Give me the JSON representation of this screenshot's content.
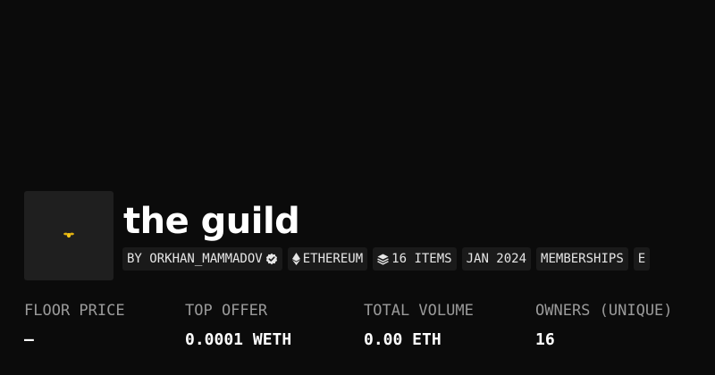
{
  "collection": {
    "name": "the guild",
    "creator_label": "BY ORKHAN_MAMMADOV",
    "creator_verified_icon": "verified-check-icon",
    "chain_label": "ETHEREUM",
    "chain_icon": "ethereum-diamond-icon",
    "items_label": "16 ITEMS",
    "items_icon": "stack-layers-icon",
    "date_label": "JAN 2024",
    "category_label": "MEMBERSHIPS",
    "overflow_chip_label": "E",
    "logo_color": "#f5c518"
  },
  "stats": [
    {
      "label": "FLOOR PRICE",
      "value": "–"
    },
    {
      "label": "TOP OFFER",
      "value": "0.0001 WETH"
    },
    {
      "label": "TOTAL VOLUME",
      "value": "0.00 ETH"
    },
    {
      "label": "OWNERS (UNIQUE)",
      "value": "16"
    }
  ],
  "colors": {
    "background": "#0b0b0b",
    "chip_background": "#1a1a1a",
    "stat_label": "#9a9a9a",
    "text": "#ffffff"
  }
}
